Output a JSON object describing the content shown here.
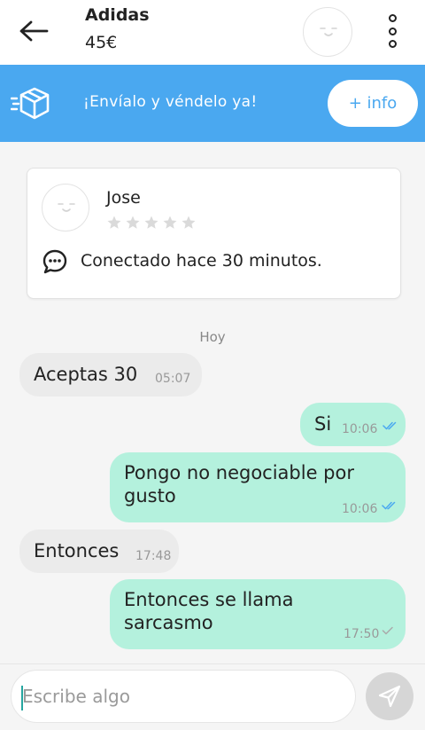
{
  "header": {
    "title": "Adidas",
    "price": "45€",
    "back_icon": "arrow-left-icon",
    "menu_icon": "more-vertical-icon"
  },
  "banner": {
    "text": "¡Envíalo y véndelo ya!",
    "button_label": "+ info",
    "icon": "fast-box-icon",
    "color": "#4aa8f0"
  },
  "user": {
    "name": "Jose",
    "rating_stars": 0,
    "max_stars": 5,
    "status": "Conectado hace 30 minutos."
  },
  "chat": {
    "date_label": "Hoy",
    "messages": [
      {
        "direction": "in",
        "text": "Aceptas 30",
        "time": "05:07"
      },
      {
        "direction": "out",
        "text": "Si",
        "time": "10:06",
        "status": "read"
      },
      {
        "direction": "out",
        "text": "Pongo no negociable por gusto",
        "time": "10:06",
        "status": "read"
      },
      {
        "direction": "in",
        "text": "Entonces",
        "time": "17:48"
      },
      {
        "direction": "out",
        "text": "Entonces se llama sarcasmo",
        "time": "17:50",
        "status": "sent"
      }
    ]
  },
  "composer": {
    "placeholder": "Escribe algo",
    "value": ""
  },
  "colors": {
    "incoming_bubble": "#ebebeb",
    "outgoing_bubble": "#b4f1dd",
    "read_check": "#4aa8f0",
    "sent_check": "#aaaaaa"
  }
}
